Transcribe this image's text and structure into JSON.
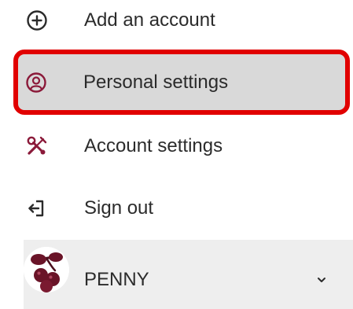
{
  "menu": {
    "items": [
      {
        "id": "add",
        "label": "Add an account",
        "icon": "plus-circle-icon"
      },
      {
        "id": "personal",
        "label": "Personal settings",
        "icon": "user-circle-icon",
        "selected": true
      },
      {
        "id": "account",
        "label": "Account settings",
        "icon": "tools-icon"
      },
      {
        "id": "signout",
        "label": "Sign out",
        "icon": "sign-out-icon"
      }
    ]
  },
  "user": {
    "name": "PENNY",
    "avatar_icon": "berries-avatar-icon",
    "expand_icon": "chevron-down-icon"
  },
  "colors": {
    "icon": "#8b1a3a",
    "highlight_border": "#e10000",
    "selected_bg": "#d9d9d9",
    "user_row_bg": "#eeeeee",
    "text": "#2b2b2b"
  }
}
